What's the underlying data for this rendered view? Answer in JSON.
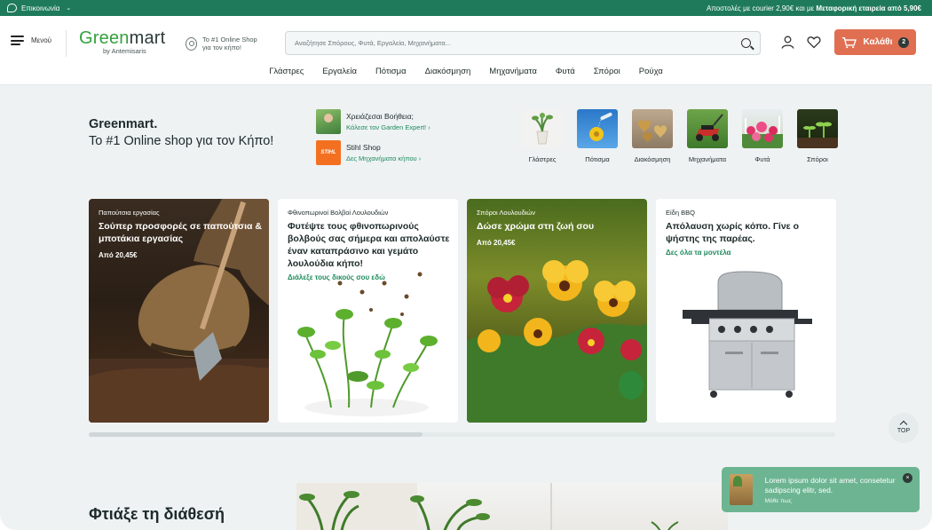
{
  "topbar": {
    "contact_label": "Επικοινωνία",
    "shipping_pre": "Αποστολές με courier 2,90€ και με ",
    "shipping_bold": "Μεταφορική εταιρεία από 5,90€"
  },
  "header": {
    "menu_label": "Μενού",
    "logo_green": "Green",
    "logo_dark": "mart",
    "logo_by": "by Antemisaris",
    "badge_line1": "Το #1 Online Shop",
    "badge_line2": "για τον κήπο!",
    "search_placeholder": "Αναζήτησε Σπόρους, Φυτά, Εργαλεία, Μηχανήματα...",
    "cart_label": "Καλάθι",
    "cart_count": "2"
  },
  "nav": [
    "Γλάστρες",
    "Εργαλεία",
    "Πότισμα",
    "Διακόσμηση",
    "Μηχανήματα",
    "Φυτά",
    "Σπόροι",
    "Ρούχα"
  ],
  "intro": {
    "title": "Greenmart.",
    "subtitle": "Το #1 Online shop για τον Κήπο!",
    "help_title": "Χρειάζεσαι Βοήθεια;",
    "help_link": "Κάλεσε τον Garden Expert!",
    "stihl_logo": "STIHL",
    "stihl_title": "Stihl Shop",
    "stihl_link": "Δες Μηχανήματα κήπου"
  },
  "categories": [
    {
      "label": "Γλάστρες",
      "icon": "pot-icon"
    },
    {
      "label": "Πότισμα",
      "icon": "watering-icon"
    },
    {
      "label": "Διακόσμηση",
      "icon": "decoration-icon"
    },
    {
      "label": "Μηχανήματα",
      "icon": "mower-icon"
    },
    {
      "label": "Φυτά",
      "icon": "flowers-icon"
    },
    {
      "label": "Σπόροι",
      "icon": "seedling-icon"
    }
  ],
  "cards": [
    {
      "caption": "Παπούτσια εργασίας",
      "headline": "Σούπερ προσφορές σε παπούτσια & μποτάκια εργασίας",
      "price": "Από 20,45€"
    },
    {
      "caption": "Φθινοπωρινοί Βολβοί Λουλουδιών",
      "headline": "Φυτέψτε τους φθινοπωρινούς βολβούς σας σήμερα και απολαύστε έναν καταπράσινο και γεμάτο λουλούδια κήπο!",
      "link": "Διάλεξε τους δικούς σου εδώ"
    },
    {
      "caption": "Σπόροι Λουλουδιών",
      "headline": "Δώσε χρώμα στη ζωή σου",
      "price": "Από 20,45€"
    },
    {
      "caption": "Είδη BBQ",
      "headline": "Απόλαυση χωρίς κόπο. Γίνε ο ψήστης της παρέας.",
      "link": "Δες όλα τα μοντέλα"
    }
  ],
  "scroll_top_label": "TOP",
  "mood_title": "Φτιάξε τη διάθεσή",
  "toast": {
    "message": "Lorem ipsum dolor sit amet, consetetur sadipscing elitr, sed.",
    "more": "Μάθε πως",
    "close": "×"
  },
  "colors": {
    "brand": "#1f7a5c",
    "accent": "#e06f52",
    "logo_green": "#35a03d",
    "link": "#1f8a5d",
    "toast": "#6db592"
  }
}
